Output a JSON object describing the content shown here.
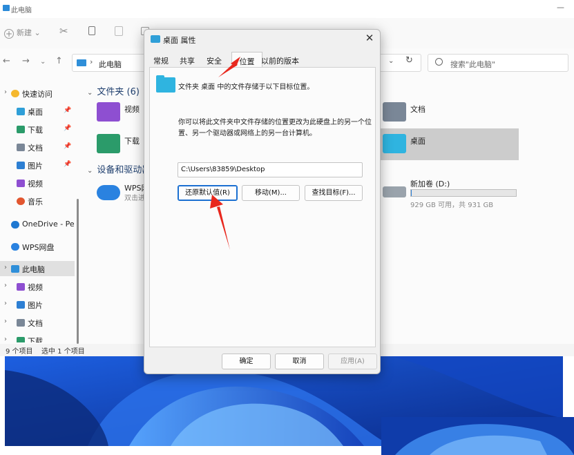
{
  "explorer": {
    "window_title": "此电脑",
    "toolbar": {
      "new_label": "新建",
      "new_caret": "⌄"
    },
    "address": {
      "path": "此电脑",
      "separator": "›"
    },
    "search_placeholder": "搜索\"此电脑\"",
    "nav_pane": [
      {
        "label": "快速访问",
        "icon": "star-icon",
        "color": "#f5b82e",
        "expand": "›"
      },
      {
        "label": "桌面",
        "icon": "desktop-icon",
        "color": "#2f9fd8",
        "pinned": true
      },
      {
        "label": "下载",
        "icon": "download-icon",
        "color": "#2b9b6a",
        "pinned": true
      },
      {
        "label": "文档",
        "icon": "document-icon",
        "color": "#7a8797",
        "pinned": true
      },
      {
        "label": "图片",
        "icon": "picture-icon",
        "color": "#2d7fd3",
        "pinned": true
      },
      {
        "label": "视频",
        "icon": "video-icon",
        "color": "#8e4fd1"
      },
      {
        "label": "音乐",
        "icon": "music-icon",
        "color": "#e2562f"
      },
      {
        "label": "OneDrive - Pers",
        "icon": "onedrive-icon",
        "color": "#1f78d1"
      },
      {
        "label": "WPS网盘",
        "icon": "wps-cloud-icon",
        "color": "#2a82e0"
      },
      {
        "label": "此电脑",
        "icon": "pc-icon",
        "color": "#2f8fd9",
        "expand": "›",
        "selected": true
      },
      {
        "label": "视频",
        "icon": "video-icon",
        "color": "#8e4fd1",
        "expand": "›"
      },
      {
        "label": "图片",
        "icon": "picture-icon",
        "color": "#2d7fd3",
        "expand": "›"
      },
      {
        "label": "文档",
        "icon": "document-icon",
        "color": "#7a8797",
        "expand": "›"
      },
      {
        "label": "下载",
        "icon": "download-icon",
        "color": "#2b9b6a",
        "expand": "›"
      }
    ],
    "content": {
      "folders_group": "文件夹 (6)",
      "devices_group": "设备和驱动器",
      "folders": [
        {
          "name": "视频",
          "color": "#8e4fd1"
        },
        {
          "name": "下载",
          "color": "#2b9b6a"
        },
        {
          "name": "文档",
          "color": "#7a8797"
        },
        {
          "name": "桌面",
          "color": "#2fb4e0"
        }
      ],
      "wps": {
        "name": "WPS网",
        "sub": "双击进"
      },
      "drive": {
        "name": "新加卷 (D:)",
        "space": "929 GB 可用，共 931 GB",
        "used_fraction": 0.002
      }
    },
    "status": {
      "count": "9 个项目",
      "selected": "选中 1 个项目"
    }
  },
  "dialog": {
    "title": "桌面 属性",
    "close": "✕",
    "tabs": [
      "常规",
      "共享",
      "安全",
      "位置",
      "以前的版本"
    ],
    "active_tab": 3,
    "location_line": "文件夹 桌面 中的文件存储于以下目标位置。",
    "description": "你可以将此文件夹中文件存储的位置更改为此硬盘上的另一个位置、另一个驱动器或网络上的另一台计算机。",
    "path": "C:\\Users\\83859\\Desktop",
    "buttons": {
      "restore": "还原默认值(R)",
      "move": "移动(M)...",
      "find": "查找目标(F)..."
    },
    "footer": {
      "ok": "确定",
      "cancel": "取消",
      "apply": "应用(A)"
    }
  },
  "colors": {
    "arrow": "#e8281e",
    "accent": "#1a6fd1",
    "wallpaper": "#0a2f8f"
  }
}
